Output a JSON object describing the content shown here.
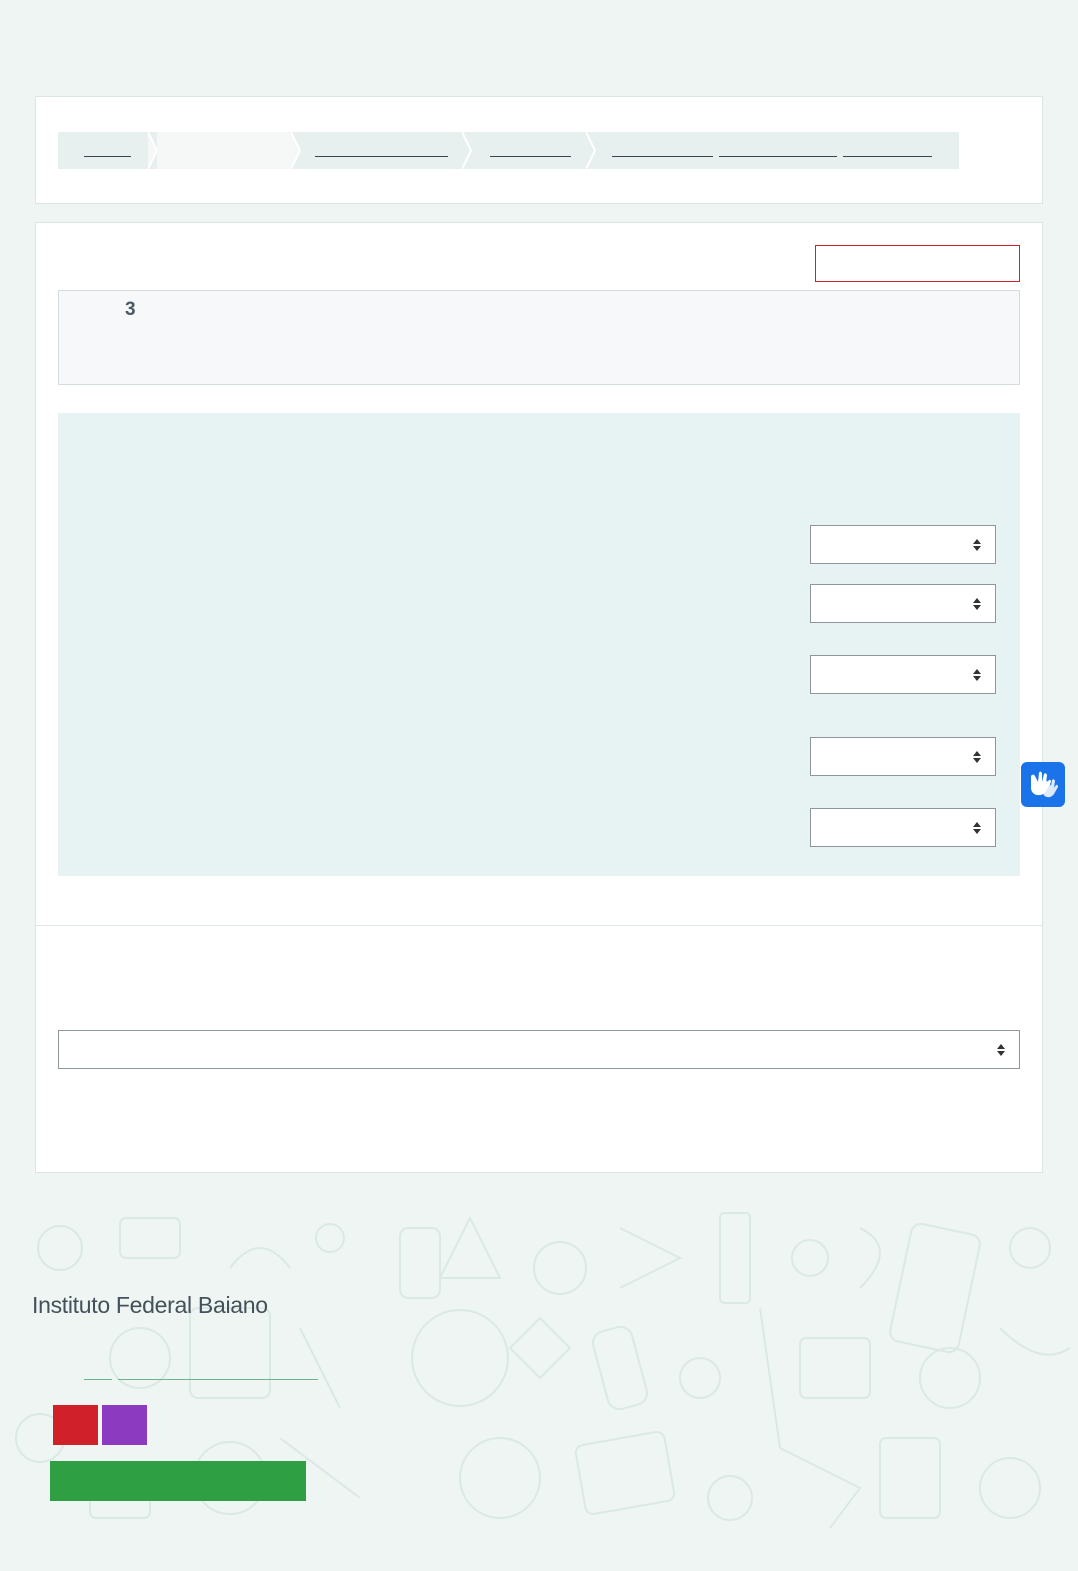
{
  "colors": {
    "page_bg": "#eef5f3",
    "accent_red": "#d0202a",
    "accent_purple": "#8c3bc0",
    "accent_green": "#2ea043",
    "vlibras_blue": "#1a73e8"
  },
  "icons": {
    "select_arrow": "up-down-caret-icon",
    "accessibility": "sign-language-hands-icon"
  },
  "info_box": {
    "number": "3"
  },
  "footer": {
    "institution_name": "Instituto Federal Baiano"
  }
}
